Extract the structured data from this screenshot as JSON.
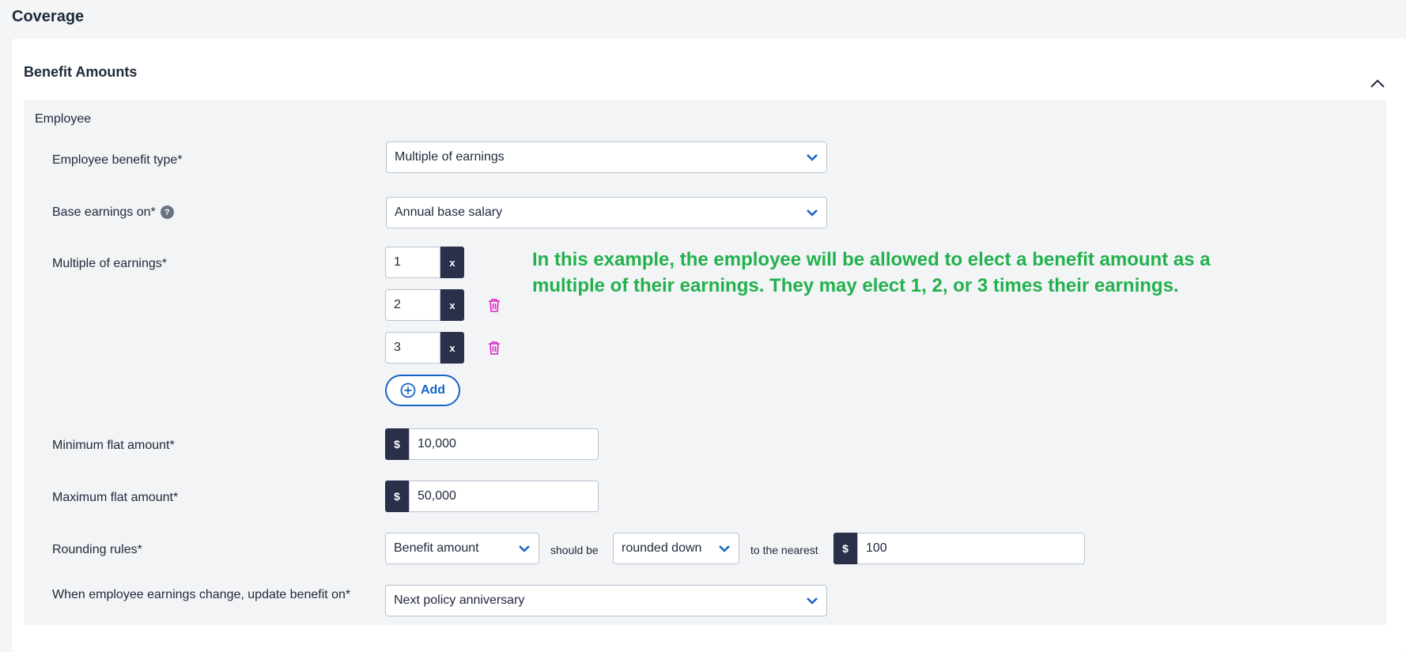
{
  "page": {
    "title": "Coverage"
  },
  "section": {
    "title": "Benefit Amounts",
    "subsection": "Employee"
  },
  "fields": {
    "benefit_type": {
      "label": "Employee benefit type*",
      "value": "Multiple of earnings"
    },
    "base_earnings": {
      "label": "Base earnings on*",
      "value": "Annual base salary",
      "help": "?"
    },
    "multiples": {
      "label": "Multiple of earnings*",
      "items": [
        {
          "value": "1",
          "suffix": "x"
        },
        {
          "value": "2",
          "suffix": "x"
        },
        {
          "value": "3",
          "suffix": "x"
        }
      ],
      "add_label": "Add"
    },
    "min_flat": {
      "label": "Minimum flat amount*",
      "prefix": "$",
      "value": "10,000"
    },
    "max_flat": {
      "label": "Maximum flat amount*",
      "prefix": "$",
      "value": "50,000"
    },
    "rounding": {
      "label": "Rounding rules*",
      "basis": "Benefit amount",
      "connector1": "should be",
      "direction": "rounded down",
      "connector2": "to the nearest",
      "prefix": "$",
      "value": "100"
    },
    "update_on": {
      "label": "When employee earnings change, update benefit on*",
      "value": "Next policy anniversary"
    }
  },
  "annotation": {
    "text": "In this example, the employee will be allowed to elect a benefit amount as a multiple of their earnings.  They may elect 1, 2, or 3 times their earnings."
  },
  "colors": {
    "accent": "#1663c7",
    "dark_badge": "#2a2f4a",
    "delete": "#e020c8",
    "annotation": "#22b14c"
  },
  "icons": {
    "collapse": "chevron-up-icon",
    "dropdown": "chevron-down-icon",
    "delete": "trash-icon",
    "add": "plus-circle-icon",
    "help": "help-icon"
  }
}
